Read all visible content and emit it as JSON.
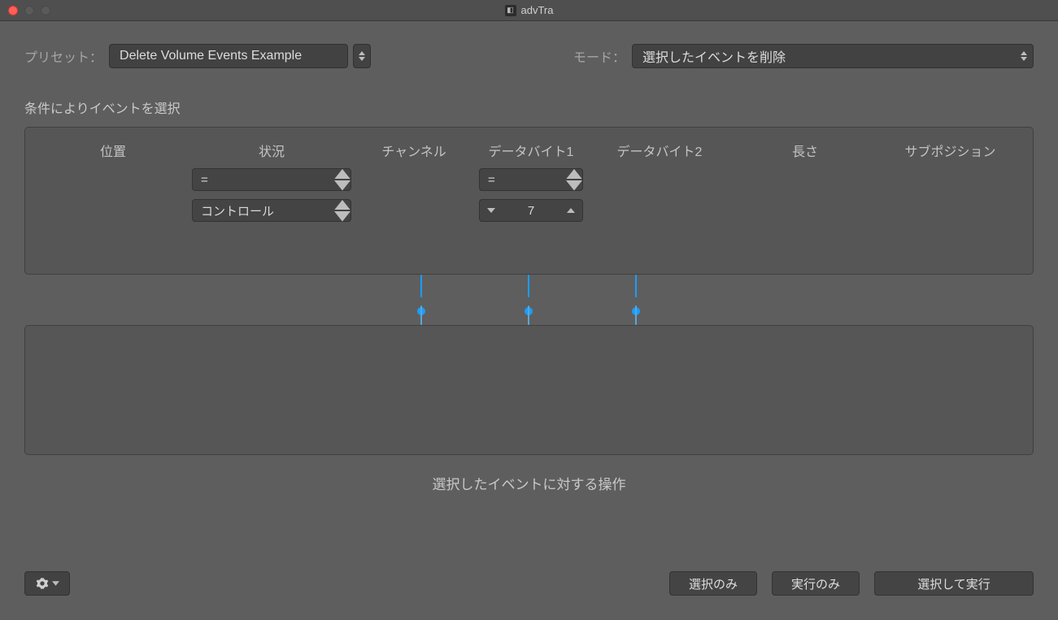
{
  "window": {
    "title": "advTra"
  },
  "top": {
    "preset_label": "プリセット：",
    "preset_value": "Delete Volume Events Example",
    "mode_label": "モード：",
    "mode_value": "選択したイベントを削除"
  },
  "conditions": {
    "heading": "条件によりイベントを選択",
    "columns": {
      "position": "位置",
      "status": "状況",
      "channel": "チャンネル",
      "data1": "データバイト1",
      "data2": "データバイト2",
      "length": "長さ",
      "subposition": "サブポジション"
    },
    "status_op": "=",
    "status_kind": "コントロール",
    "data1_op": "=",
    "data1_value": "7"
  },
  "operations": {
    "caption": "選択したイベントに対する操作"
  },
  "buttons": {
    "select_only": "選択のみ",
    "execute_only": "実行のみ",
    "select_and_execute": "選択して実行"
  },
  "colors": {
    "slider": "#1a9dff"
  }
}
